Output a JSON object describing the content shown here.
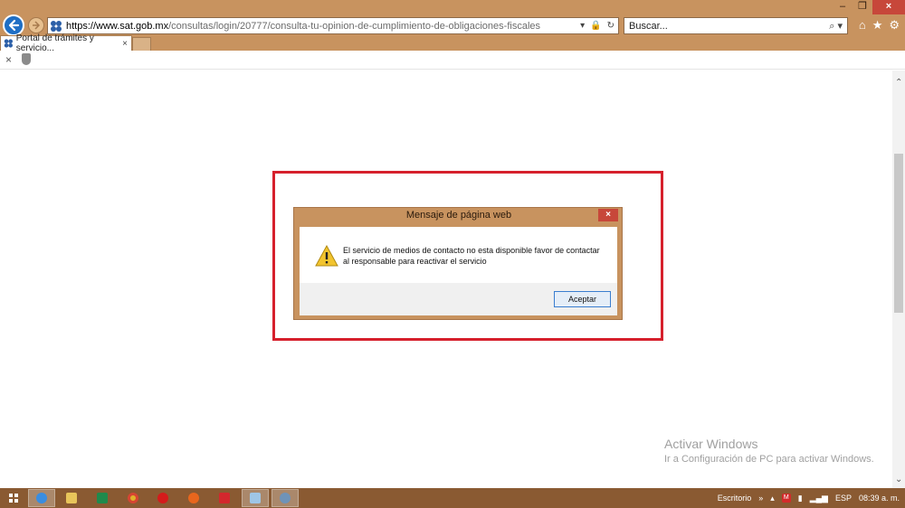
{
  "browser": {
    "url_host": "https://www.sat.gob.mx",
    "url_path": "/consultas/login/20777/consulta-tu-opinion-de-cumplimiento-de-obligaciones-fiscales",
    "search_placeholder": "Buscar...",
    "tab_title": "Portal de trámites y servicio...",
    "tab_close": "×",
    "cmd_close": "×"
  },
  "window_controls": {
    "minimize": "–",
    "restore": "❐",
    "close": "×"
  },
  "dialog": {
    "title": "Mensaje de página web",
    "close": "×",
    "message_line1": "El servicio de medios  de contacto no esta disponible favor de contactar",
    "message_line2": "al responsable para reactivar el servicio",
    "ok_label": "Aceptar"
  },
  "watermark": {
    "line1": "Activar Windows",
    "line2": "Ir a Configuración de PC para activar Windows."
  },
  "taskbar": {
    "desktop_label": "Escritorio",
    "chevron": "»",
    "language": "ESP",
    "time": "08:39 a. m."
  },
  "colors": {
    "accent_chrome": "#c8935f",
    "highlight_red": "#d6202c",
    "taskbar": "#8a5a32"
  }
}
